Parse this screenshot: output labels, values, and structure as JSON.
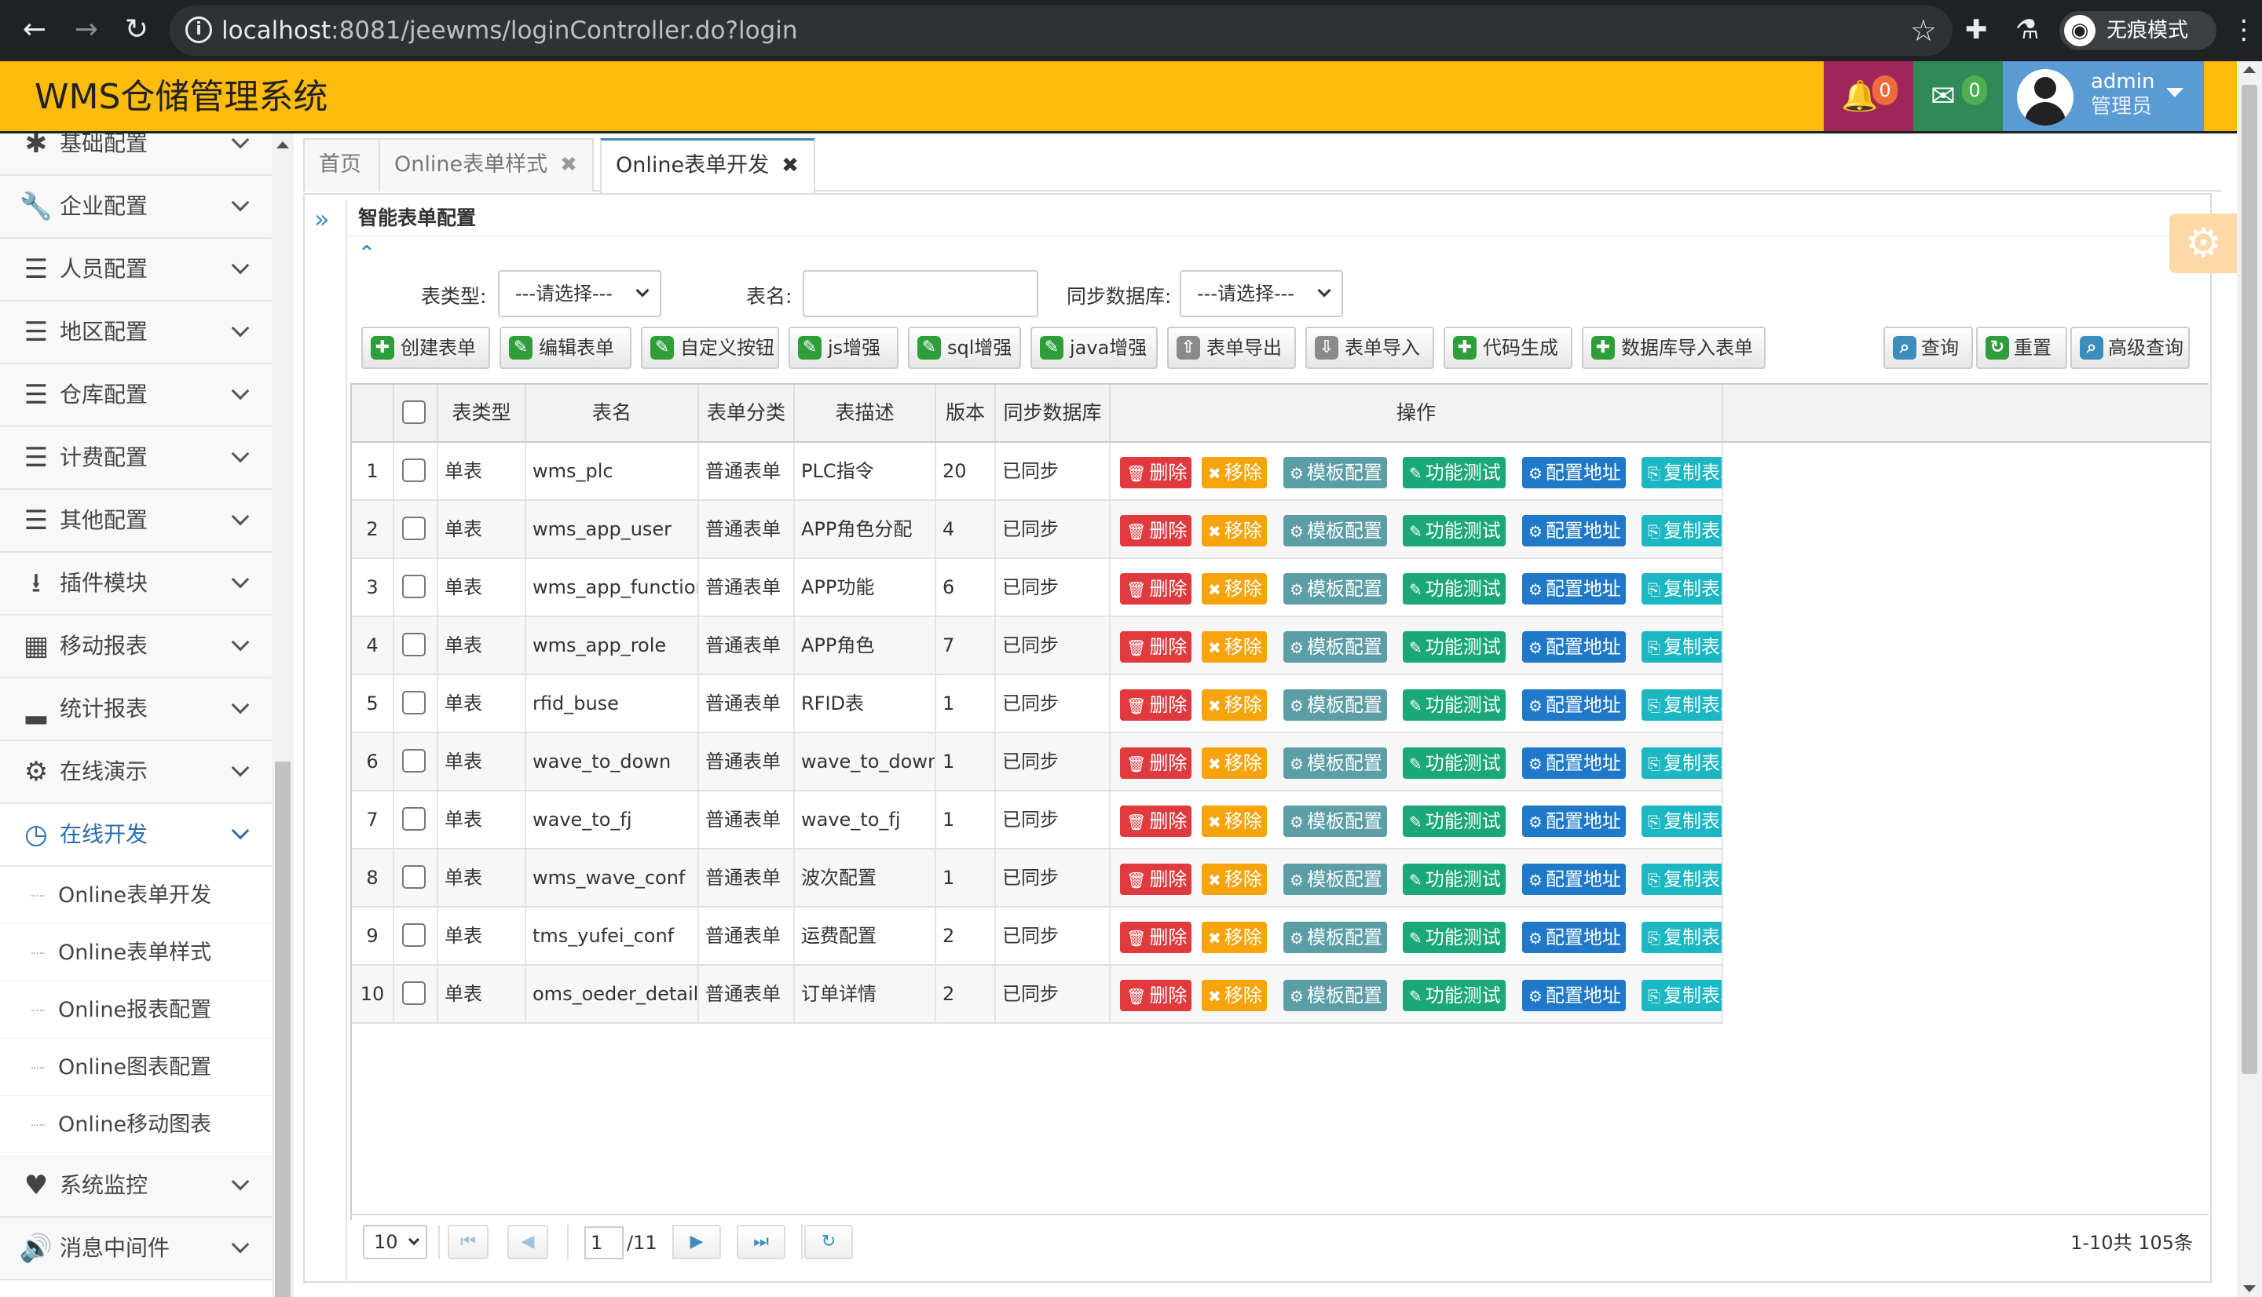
{
  "browser": {
    "url_host": "localhost",
    "url_rest": ":8081/jeewms/loginController.do?login",
    "incognito_label": "无痕模式"
  },
  "header": {
    "title": "WMS仓储管理系统",
    "notifications": "0",
    "messages": "0",
    "user_name": "admin",
    "user_role": "管理员"
  },
  "sidebar": {
    "items": [
      {
        "label": "基础配置",
        "icon": "asterisk-icon"
      },
      {
        "label": "企业配置",
        "icon": "wrench-icon"
      },
      {
        "label": "人员配置",
        "icon": "list-icon"
      },
      {
        "label": "地区配置",
        "icon": "list-icon"
      },
      {
        "label": "仓库配置",
        "icon": "list-icon"
      },
      {
        "label": "计费配置",
        "icon": "list-icon"
      },
      {
        "label": "其他配置",
        "icon": "list-icon"
      },
      {
        "label": "插件模块",
        "icon": "download-icon"
      },
      {
        "label": "移动报表",
        "icon": "grid-icon"
      },
      {
        "label": "统计报表",
        "icon": "signal-icon"
      },
      {
        "label": "在线演示",
        "icon": "gear-icon"
      },
      {
        "label": "在线开发",
        "icon": "clock-icon"
      }
    ],
    "sub_items": [
      "Online表单开发",
      "Online表单样式",
      "Online报表配置",
      "Online图表配置",
      "Online移动图表"
    ],
    "bottom_items": [
      {
        "label": "系统监控",
        "icon": "heart-icon"
      },
      {
        "label": "消息中间件",
        "icon": "volume-icon"
      }
    ]
  },
  "tabs": [
    {
      "label": "首页"
    },
    {
      "label": "Online表单样式"
    },
    {
      "label": "Online表单开发"
    }
  ],
  "panel": {
    "title": "智能表单配置"
  },
  "search": {
    "table_type_label": "表类型:",
    "table_type_value": "---请选择---",
    "table_name_label": "表名:",
    "table_name_value": "",
    "sync_label": "同步数据库:",
    "sync_value": "---请选择---"
  },
  "toolbar": {
    "buttons": [
      "创建表单",
      "编辑表单",
      "自定义按钮",
      "js增强",
      "sql增强",
      "java增强",
      "表单导出",
      "表单导入",
      "代码生成",
      "数据库导入表单"
    ],
    "right_buttons": [
      "查询",
      "重置",
      "高级查询"
    ]
  },
  "grid": {
    "headers": [
      "表类型",
      "表名",
      "表单分类",
      "表描述",
      "版本",
      "同步数据库",
      "操作"
    ],
    "actions": [
      "删除",
      "移除",
      "模板配置",
      "功能测试",
      "配置地址",
      "复制表单"
    ],
    "rows": [
      {
        "no": "1",
        "type": "单表",
        "name": "wms_plc",
        "category": "普通表单",
        "desc": "PLC指令",
        "version": "20",
        "sync": "已同步"
      },
      {
        "no": "2",
        "type": "单表",
        "name": "wms_app_user",
        "category": "普通表单",
        "desc": "APP角色分配",
        "version": "4",
        "sync": "已同步"
      },
      {
        "no": "3",
        "type": "单表",
        "name": "wms_app_function",
        "category": "普通表单",
        "desc": "APP功能",
        "version": "6",
        "sync": "已同步"
      },
      {
        "no": "4",
        "type": "单表",
        "name": "wms_app_role",
        "category": "普通表单",
        "desc": "APP角色",
        "version": "7",
        "sync": "已同步"
      },
      {
        "no": "5",
        "type": "单表",
        "name": "rfid_buse",
        "category": "普通表单",
        "desc": "RFID表",
        "version": "1",
        "sync": "已同步"
      },
      {
        "no": "6",
        "type": "单表",
        "name": "wave_to_down",
        "category": "普通表单",
        "desc": "wave_to_down",
        "version": "1",
        "sync": "已同步"
      },
      {
        "no": "7",
        "type": "单表",
        "name": "wave_to_fj",
        "category": "普通表单",
        "desc": "wave_to_fj",
        "version": "1",
        "sync": "已同步"
      },
      {
        "no": "8",
        "type": "单表",
        "name": "wms_wave_conf",
        "category": "普通表单",
        "desc": "波次配置",
        "version": "1",
        "sync": "已同步"
      },
      {
        "no": "9",
        "type": "单表",
        "name": "tms_yufei_conf",
        "category": "普通表单",
        "desc": "运费配置",
        "version": "2",
        "sync": "已同步"
      },
      {
        "no": "10",
        "type": "单表",
        "name": "oms_oeder_detail",
        "category": "普通表单",
        "desc": "订单详情",
        "version": "2",
        "sync": "已同步"
      }
    ]
  },
  "pager": {
    "page_size": "10",
    "current_page": "1",
    "total_pages": "/11",
    "summary": "1-10共 105条"
  }
}
